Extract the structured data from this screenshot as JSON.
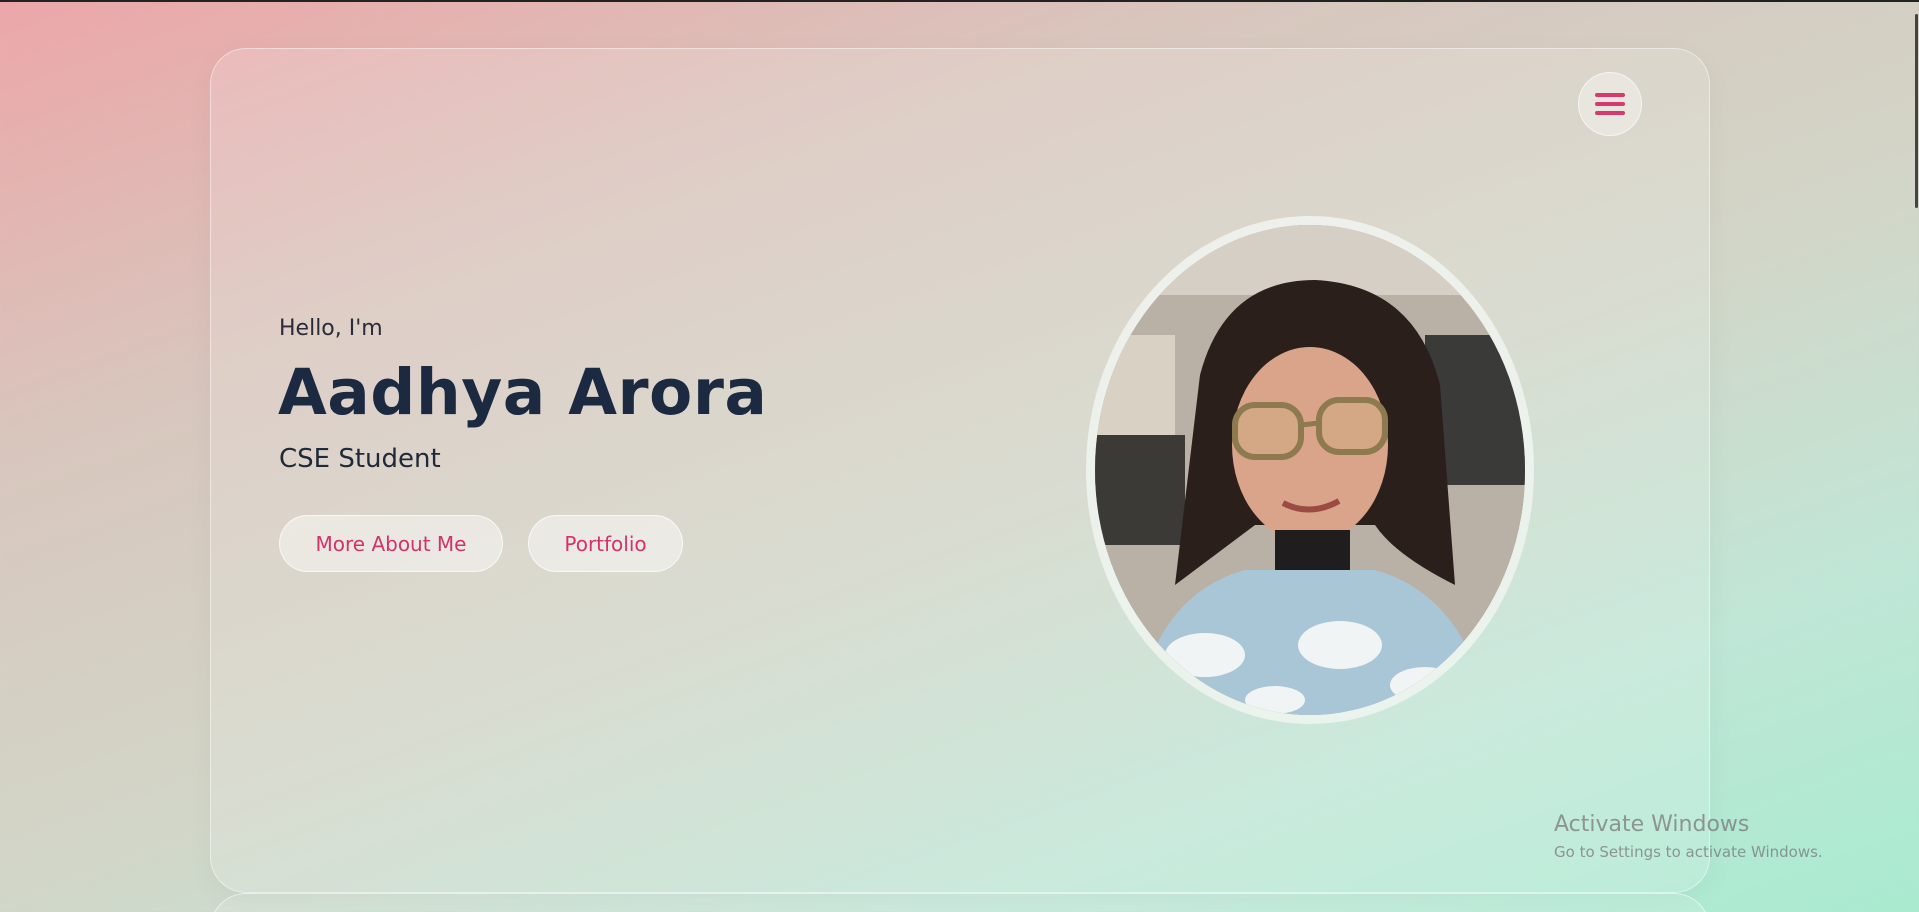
{
  "header": {
    "menu_icon": "hamburger-menu-icon"
  },
  "hero": {
    "greeting": "Hello, I'm",
    "name": "Aadhya Arora",
    "role": "CSE Student",
    "buttons": {
      "about_label": "More About Me",
      "portfolio_label": "Portfolio"
    },
    "portrait_alt": ""
  },
  "watermark": {
    "title": "Activate Windows",
    "subtitle": "Go to Settings to activate Windows."
  },
  "colors": {
    "accent": "#d4326a",
    "heading": "#1b2a41",
    "gradient_start": "#eca6a8",
    "gradient_end": "#a9ebd0"
  }
}
